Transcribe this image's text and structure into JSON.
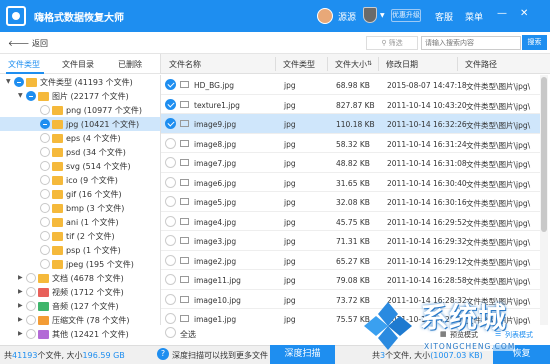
{
  "app": {
    "title": "嗨格式数据恢复大师",
    "user": "源源",
    "vip": "优惠升级",
    "service": "客服",
    "menu": "菜单"
  },
  "toolbar": {
    "back": "返回",
    "filter": "筛选",
    "search_placeholder": "请输入搜索内容",
    "search": "搜索"
  },
  "tabs": [
    "文件类型",
    "文件目录",
    "已删除"
  ],
  "tree": [
    {
      "label": "文件类型 (41193 个文件)",
      "level": 0,
      "state": "minus",
      "arrow": "▼",
      "color": "#f5b93b"
    },
    {
      "label": "图片 (22177 个文件)",
      "level": 1,
      "state": "minus",
      "arrow": "▼",
      "color": "#f5b93b"
    },
    {
      "label": "png (10977 个文件)",
      "level": 2,
      "state": "empty",
      "arrow": "",
      "color": "#f5b93b"
    },
    {
      "label": "jpg (10421 个文件)",
      "level": 2,
      "state": "minus",
      "arrow": "",
      "color": "#f5b93b",
      "selected": true
    },
    {
      "label": "eps (4 个文件)",
      "level": 2,
      "state": "empty",
      "arrow": "",
      "color": "#f5b93b"
    },
    {
      "label": "psd (34 个文件)",
      "level": 2,
      "state": "empty",
      "arrow": "",
      "color": "#f5b93b"
    },
    {
      "label": "svg (514 个文件)",
      "level": 2,
      "state": "empty",
      "arrow": "",
      "color": "#f5b93b"
    },
    {
      "label": "ico (9 个文件)",
      "level": 2,
      "state": "empty",
      "arrow": "",
      "color": "#f5b93b"
    },
    {
      "label": "gif (16 个文件)",
      "level": 2,
      "state": "empty",
      "arrow": "",
      "color": "#f5b93b"
    },
    {
      "label": "bmp (3 个文件)",
      "level": 2,
      "state": "empty",
      "arrow": "",
      "color": "#f5b93b"
    },
    {
      "label": "ani (1 个文件)",
      "level": 2,
      "state": "empty",
      "arrow": "",
      "color": "#f5b93b"
    },
    {
      "label": "tif (2 个文件)",
      "level": 2,
      "state": "empty",
      "arrow": "",
      "color": "#f5b93b"
    },
    {
      "label": "psp (1 个文件)",
      "level": 2,
      "state": "empty",
      "arrow": "",
      "color": "#f5b93b"
    },
    {
      "label": "jpeg (195 个文件)",
      "level": 2,
      "state": "empty",
      "arrow": "",
      "color": "#f5b93b"
    },
    {
      "label": "文档 (4678 个文件)",
      "level": 1,
      "state": "empty",
      "arrow": "▶",
      "color": "#f5b93b"
    },
    {
      "label": "视频 (1712 个文件)",
      "level": 1,
      "state": "empty",
      "arrow": "▶",
      "color": "#e8605a"
    },
    {
      "label": "音频 (127 个文件)",
      "level": 1,
      "state": "empty",
      "arrow": "▶",
      "color": "#3fb56b"
    },
    {
      "label": "压缩文件 (78 个文件)",
      "level": 1,
      "state": "empty",
      "arrow": "▶",
      "color": "#f39c35"
    },
    {
      "label": "其他 (12421 个文件)",
      "level": 1,
      "state": "empty",
      "arrow": "▶",
      "color": "#b36ad6"
    }
  ],
  "columns": [
    "文件名称",
    "文件类型",
    "文件大小",
    "修改日期",
    "文件路径"
  ],
  "files": [
    {
      "name": "HD_BG.jpg",
      "type": "jpg",
      "size": "68.98 KB",
      "date": "2015-08-07 14:47:18",
      "path": "文件类型\\图片\\jpg\\",
      "checked": true
    },
    {
      "name": "texture1.jpg",
      "type": "jpg",
      "size": "827.87 KB",
      "date": "2011-10-14 10:43:20",
      "path": "文件类型\\图片\\jpg\\",
      "checked": true
    },
    {
      "name": "image9.jpg",
      "type": "jpg",
      "size": "110.18 KB",
      "date": "2011-10-14 16:32:26",
      "path": "文件类型\\图片\\jpg\\",
      "checked": true,
      "selected": true
    },
    {
      "name": "image8.jpg",
      "type": "jpg",
      "size": "58.32 KB",
      "date": "2011-10-14 16:31:24",
      "path": "文件类型\\图片\\jpg\\",
      "checked": false
    },
    {
      "name": "image7.jpg",
      "type": "jpg",
      "size": "48.82 KB",
      "date": "2011-10-14 16:31:08",
      "path": "文件类型\\图片\\jpg\\",
      "checked": false
    },
    {
      "name": "image6.jpg",
      "type": "jpg",
      "size": "31.65 KB",
      "date": "2011-10-14 16:30:40",
      "path": "文件类型\\图片\\jpg\\",
      "checked": false
    },
    {
      "name": "image5.jpg",
      "type": "jpg",
      "size": "32.08 KB",
      "date": "2011-10-14 16:30:16",
      "path": "文件类型\\图片\\jpg\\",
      "checked": false
    },
    {
      "name": "image4.jpg",
      "type": "jpg",
      "size": "45.75 KB",
      "date": "2011-10-14 16:29:52",
      "path": "文件类型\\图片\\jpg\\",
      "checked": false
    },
    {
      "name": "image3.jpg",
      "type": "jpg",
      "size": "71.31 KB",
      "date": "2011-10-14 16:29:32",
      "path": "文件类型\\图片\\jpg\\",
      "checked": false
    },
    {
      "name": "image2.jpg",
      "type": "jpg",
      "size": "65.27 KB",
      "date": "2011-10-14 16:29:12",
      "path": "文件类型\\图片\\jpg\\",
      "checked": false
    },
    {
      "name": "image11.jpg",
      "type": "jpg",
      "size": "79.08 KB",
      "date": "2011-10-14 16:28:58",
      "path": "文件类型\\图片\\jpg\\",
      "checked": false
    },
    {
      "name": "image10.jpg",
      "type": "jpg",
      "size": "73.72 KB",
      "date": "2011-10-14 16:28:32",
      "path": "文件类型\\图片\\jpg\\",
      "checked": false
    },
    {
      "name": "image1.jpg",
      "type": "jpg",
      "size": "75.57 KB",
      "date": "2011-10-14 16:28:06",
      "path": "文件类型\\图片\\jpg\\",
      "checked": false
    }
  ],
  "select_all": "全选",
  "view": {
    "preview": "预览模式",
    "list": "列表模式"
  },
  "status": {
    "total_prefix": "共",
    "total_count": "41193",
    "total_mid": "个文件, 大小",
    "total_size": "196.59 GB",
    "deep_hint": "深度扫描可以找到更多文件",
    "deep_btn": "深度扫描",
    "sel_prefix": "共",
    "sel_count": "3",
    "sel_mid": "个文件, 大小",
    "sel_size": "(1007.03 KB)",
    "restore": "恢复"
  },
  "watermark": {
    "text": "系统城",
    "sub": "XITONGCHENG.COM"
  },
  "colors": {
    "accent": "#1e8ef0",
    "selected_row": "#cfe6fb"
  }
}
